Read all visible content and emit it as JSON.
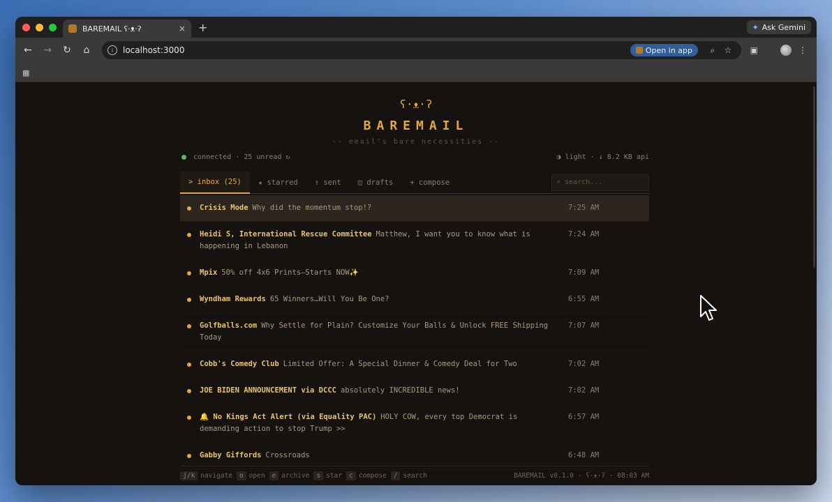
{
  "browser": {
    "tab_title": "BAREMAIL ʕ·ᴥ·ʔ",
    "tab_close": "×",
    "new_tab": "+",
    "ask_gemini": "Ask Gemini",
    "url": "localhost:3000",
    "open_in_app": "Open in app",
    "traffic_colors": [
      "#ff5f57",
      "#febc2e",
      "#28c840"
    ]
  },
  "app": {
    "logo_face": "ʕ·ᴥ·ʔ",
    "title": "BAREMAIL",
    "tagline": "-- email's bare necessities --",
    "status": {
      "connected": "connected",
      "unread": "· 25 unread",
      "refresh": "↻",
      "theme": "◑ light",
      "api": "· ↓ 8.2 KB api"
    },
    "tabs": [
      {
        "label": "> inbox (25)"
      },
      {
        "label": "★ starred"
      },
      {
        "label": "↑ sent"
      },
      {
        "label": "◫ drafts"
      },
      {
        "label": "+ compose"
      }
    ],
    "search_placeholder": "search...",
    "emails": [
      {
        "sender": "Crisis Mode",
        "subject": "Why did the momentum stop!?",
        "time": "7:25 AM"
      },
      {
        "sender": "Heidi S, International Rescue Committee",
        "subject": "Matthew, I want you to know what is happening in Lebanon",
        "time": "7:24 AM"
      },
      {
        "sender": "Mpix",
        "subject": "50% off 4x6 Prints—Starts NOW✨",
        "time": "7:09 AM"
      },
      {
        "sender": "Wyndham Rewards",
        "subject": "65 Winners…Will You Be One?",
        "time": "6:55 AM"
      },
      {
        "sender": "Golfballs.com",
        "subject": "Why Settle for Plain? Customize Your Balls & Unlock FREE Shipping Today",
        "time": "7:07 AM"
      },
      {
        "sender": "Cobb's Comedy Club",
        "subject": "Limited Offer: A Special Dinner & Comedy Deal for Two",
        "time": "7:02 AM"
      },
      {
        "sender": "JOE BIDEN ANNOUNCEMENT via DCCC",
        "subject": "absolutely INCREDIBLE news!",
        "time": "7:02 AM"
      },
      {
        "sender": "🔔 No Kings Act Alert (via Equality PAC)",
        "subject": "HOLY COW, every top Democrat is demanding action to stop Trump >>",
        "time": "6:57 AM"
      },
      {
        "sender": "Gabby Giffords",
        "subject": "Crossroads",
        "time": "6:48 AM"
      }
    ],
    "footer": {
      "shortcuts": [
        {
          "key": "j/k",
          "label": "navigate"
        },
        {
          "key": "o",
          "label": "open"
        },
        {
          "key": "e",
          "label": "archive"
        },
        {
          "key": "s",
          "label": "star"
        },
        {
          "key": "c",
          "label": "compose"
        },
        {
          "key": "/",
          "label": "search"
        }
      ],
      "version": "BAREMAIL v0.1.0 · ʕ·ᴥ·ʔ · 08:03 AM"
    },
    "accent": "#e5a935"
  }
}
